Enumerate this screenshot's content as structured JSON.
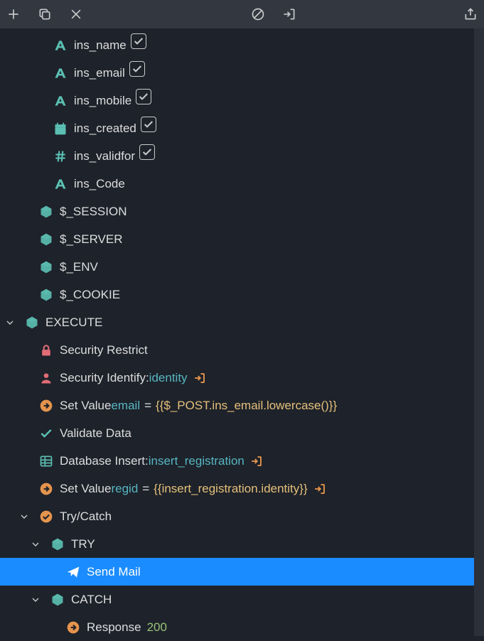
{
  "toolbar": {
    "add": "plus",
    "copy": "copy",
    "close": "x",
    "nosign": "no",
    "exit": "exit",
    "share": "share"
  },
  "fields": [
    {
      "icon": "text",
      "label": "ins_name",
      "checked": true
    },
    {
      "icon": "text",
      "label": "ins_email",
      "checked": true
    },
    {
      "icon": "text",
      "label": "ins_mobile",
      "checked": true
    },
    {
      "icon": "date",
      "label": "ins_created",
      "checked": true
    },
    {
      "icon": "hash",
      "label": "ins_validfor",
      "checked": true
    },
    {
      "icon": "text",
      "label": "ins_Code",
      "checked": false
    }
  ],
  "superglobals": [
    {
      "label": "$_SESSION"
    },
    {
      "label": "$_SERVER"
    },
    {
      "label": "$_ENV"
    },
    {
      "label": "$_COOKIE"
    }
  ],
  "execute": {
    "label": "EXECUTE",
    "steps": {
      "securityRestrict": "Security Restrict",
      "securityIdentifyLabel": "Security Identify: ",
      "securityIdentifyValue": "identity",
      "setValue1Label": "Set Value ",
      "setValue1Var": "email",
      "setValue1Expr": "{{$_POST.ins_email.lowercase()}}",
      "validateData": "Validate Data",
      "dbInsertLabel": "Database Insert: ",
      "dbInsertValue": "insert_registration",
      "setValue2Label": "Set Value ",
      "setValue2Var": "regid",
      "setValue2Expr": "{{insert_registration.identity}}",
      "tryCatch": "Try/Catch",
      "try": "TRY",
      "sendMail": "Send Mail",
      "catch": "CATCH",
      "responseLabel": "Response ",
      "responseCode": "200"
    }
  }
}
